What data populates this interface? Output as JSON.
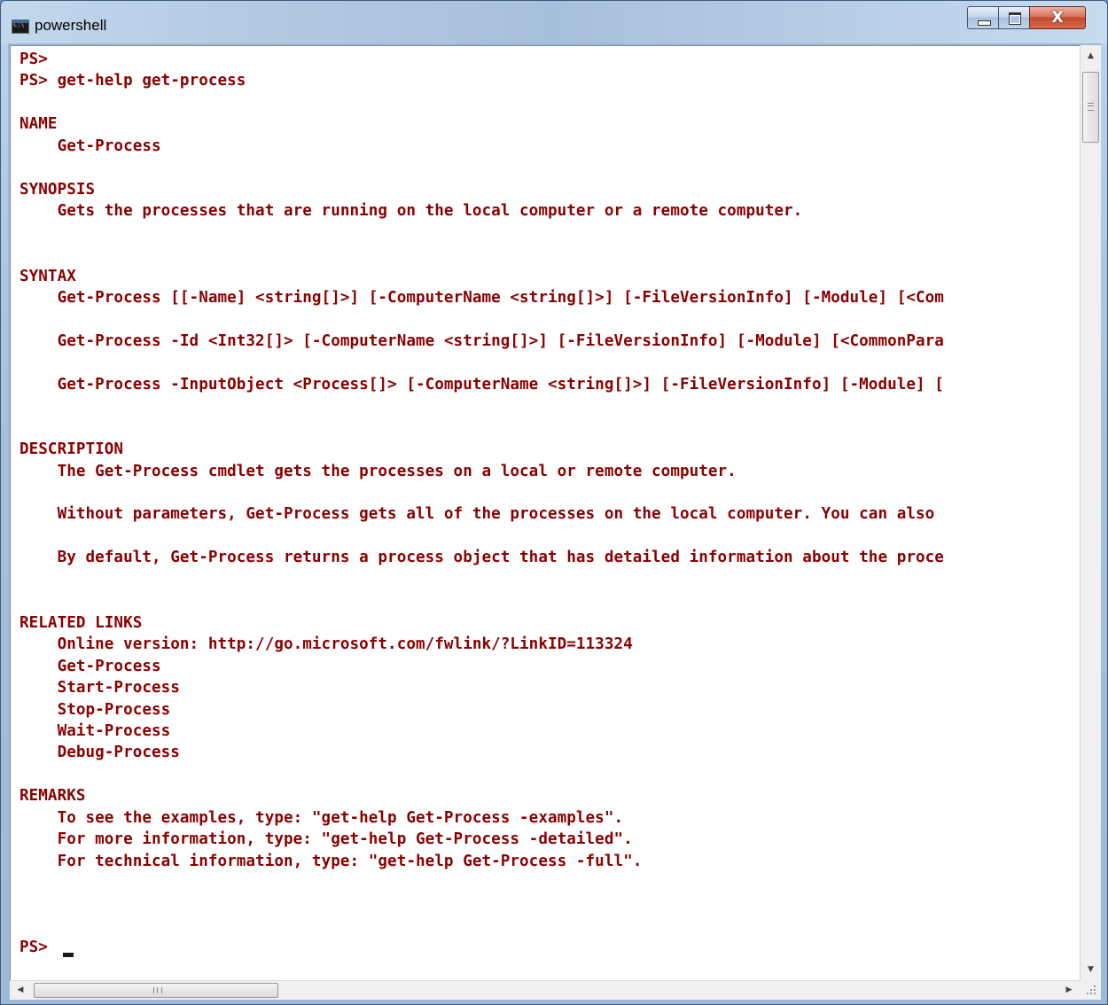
{
  "window": {
    "title": "powershell",
    "icon": "console-app-icon",
    "controls": {
      "minimize_icon": "minimize-icon",
      "maximize_icon": "maximize-icon",
      "close_label": "X"
    }
  },
  "console": {
    "text_color": "#8b0000",
    "background": "#ffffff",
    "lines": [
      "PS>",
      "PS> get-help get-process",
      "",
      "NAME",
      "    Get-Process",
      "",
      "SYNOPSIS",
      "    Gets the processes that are running on the local computer or a remote computer.",
      "",
      "",
      "SYNTAX",
      "    Get-Process [[-Name] <string[]>] [-ComputerName <string[]>] [-FileVersionInfo] [-Module] [<Com",
      "",
      "    Get-Process -Id <Int32[]> [-ComputerName <string[]>] [-FileVersionInfo] [-Module] [<CommonPara",
      "",
      "    Get-Process -InputObject <Process[]> [-ComputerName <string[]>] [-FileVersionInfo] [-Module] [",
      "",
      "",
      "DESCRIPTION",
      "    The Get-Process cmdlet gets the processes on a local or remote computer.",
      "",
      "    Without parameters, Get-Process gets all of the processes on the local computer. You can also",
      "",
      "    By default, Get-Process returns a process object that has detailed information about the proce",
      "",
      "",
      "RELATED LINKS",
      "    Online version: http://go.microsoft.com/fwlink/?LinkID=113324",
      "    Get-Process",
      "    Start-Process",
      "    Stop-Process",
      "    Wait-Process",
      "    Debug-Process",
      "",
      "REMARKS",
      "    To see the examples, type: \"get-help Get-Process -examples\".",
      "    For more information, type: \"get-help Get-Process -detailed\".",
      "    For technical information, type: \"get-help Get-Process -full\".",
      "",
      "",
      "",
      "PS> "
    ]
  },
  "scrollbars": {
    "up_arrow": "▲",
    "down_arrow": "▼",
    "left_arrow": "◀",
    "right_arrow": "▶",
    "vertical_position": 0.0,
    "horizontal_position": 0.0
  }
}
